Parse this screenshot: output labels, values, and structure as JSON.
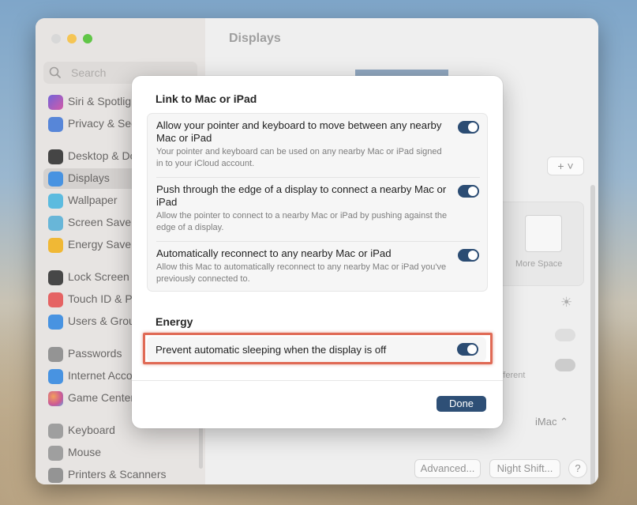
{
  "sidebar": {
    "search_placeholder": "Search",
    "items": [
      {
        "label": "Siri & Spotlight",
        "icon": "siri-icon",
        "color": "#b24fb8"
      },
      {
        "label": "Privacy & Security",
        "icon": "hand-icon",
        "color": "#4d7fd6"
      },
      {
        "label": "Desktop & Dock",
        "icon": "dock-icon",
        "color": "#3a3a3a"
      },
      {
        "label": "Displays",
        "icon": "sun-icon",
        "color": "#3d8de0"
      },
      {
        "label": "Wallpaper",
        "icon": "flower-icon",
        "color": "#52b7de"
      },
      {
        "label": "Screen Saver",
        "icon": "screensaver-icon",
        "color": "#5fb2d6"
      },
      {
        "label": "Energy Saver",
        "icon": "lightbulb-icon",
        "color": "#f0b429"
      },
      {
        "label": "Lock Screen",
        "icon": "lock-icon",
        "color": "#3c3c3c"
      },
      {
        "label": "Touch ID & Password",
        "icon": "fingerprint-icon",
        "color": "#e45a5a"
      },
      {
        "label": "Users & Groups",
        "icon": "users-icon",
        "color": "#3d8de0"
      },
      {
        "label": "Passwords",
        "icon": "key-icon",
        "color": "#8e8e8e"
      },
      {
        "label": "Internet Accounts",
        "icon": "at-icon",
        "color": "#3d8de0"
      },
      {
        "label": "Game Center",
        "icon": "gamecenter-icon",
        "color": "#e8a33b"
      },
      {
        "label": "Keyboard",
        "icon": "keyboard-icon",
        "color": "#9a9a9a"
      },
      {
        "label": "Mouse",
        "icon": "mouse-icon",
        "color": "#9a9a9a"
      },
      {
        "label": "Printers & Scanners",
        "icon": "printer-icon",
        "color": "#8e8e8e"
      }
    ]
  },
  "main": {
    "title": "Displays",
    "more_space_label": "More Space",
    "different_label": "ifferent",
    "display_select": "iMac",
    "advanced_button": "Advanced...",
    "night_shift_button": "Night Shift...",
    "help_button": "?"
  },
  "sheet": {
    "link_section_title": "Link to Mac or iPad",
    "rows": [
      {
        "title": "Allow your pointer and keyboard to move between any nearby Mac or iPad",
        "desc": "Your pointer and keyboard can be used on any nearby Mac or iPad signed in to your iCloud account.",
        "on": true
      },
      {
        "title": "Push through the edge of a display to connect a nearby Mac or iPad",
        "desc": "Allow the pointer to connect to a nearby Mac or iPad by pushing against the edge of a display.",
        "on": true
      },
      {
        "title": "Automatically reconnect to any nearby Mac or iPad",
        "desc": "Allow this Mac to automatically reconnect to any nearby Mac or iPad you've previously connected to.",
        "on": true
      }
    ],
    "energy_section_title": "Energy",
    "energy_row": {
      "title": "Prevent automatic sleeping when the display is off",
      "on": true
    },
    "done_button": "Done"
  },
  "colors": {
    "toggle_on": "#2b4c73",
    "done_button": "#2e4f76",
    "highlight_border": "#e06a55"
  }
}
